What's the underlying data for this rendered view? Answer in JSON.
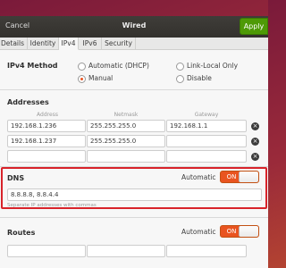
{
  "titlebar": {
    "cancel": "Cancel",
    "title": "Wired",
    "apply": "Apply"
  },
  "tabs": [
    "Details",
    "Identity",
    "IPv4",
    "IPv6",
    "Security"
  ],
  "ipv4_method": {
    "label": "IPv4 Method",
    "options": [
      "Automatic (DHCP)",
      "Link-Local Only",
      "Manual",
      "Disable"
    ],
    "selected": "Manual"
  },
  "addresses": {
    "label": "Addresses",
    "columns": [
      "Address",
      "Netmask",
      "Gateway"
    ],
    "rows": [
      [
        "192.168.1.236",
        "255.255.255.0",
        "192.168.1.1"
      ],
      [
        "192.168.1.237",
        "255.255.255.0",
        ""
      ],
      [
        "",
        "",
        ""
      ]
    ]
  },
  "dns": {
    "label": "DNS",
    "automatic_label": "Automatic",
    "toggle_state": "ON",
    "value": "8.8.8.8, 8.8.4.4",
    "hint": "Separate IP addresses with commas"
  },
  "routes": {
    "label": "Routes",
    "automatic_label": "Automatic",
    "toggle_state": "ON"
  },
  "colors": {
    "accent": "#e95420",
    "apply": "#4e9a06",
    "highlight": "#d8232a"
  }
}
